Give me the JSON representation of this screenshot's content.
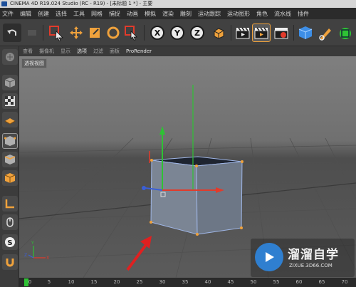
{
  "window": {
    "title": "CINEMA 4D R19.024 Studio (RC - R19) - [未标题 1 *] - 主要"
  },
  "menubar": {
    "items": [
      "文件",
      "编辑",
      "创建",
      "选择",
      "工具",
      "网格",
      "捕捉",
      "动画",
      "模拟",
      "渲染",
      "雕刻",
      "运动跟踪",
      "运动图形",
      "角色",
      "流水线",
      "插件"
    ]
  },
  "toolbar": {
    "axis_x": "X",
    "axis_y": "Y",
    "axis_z": "Z"
  },
  "viewport_menu": {
    "items": [
      "查看",
      "摄像机",
      "显示",
      "选项",
      "过滤",
      "面板",
      "ProRender"
    ]
  },
  "viewport": {
    "label": "透视视图",
    "axis_x_label": "X",
    "axis_y_label": "Y",
    "axis_z_label": "Z"
  },
  "timeline": {
    "ticks": [
      "0",
      "5",
      "10",
      "15",
      "20",
      "25",
      "30",
      "35",
      "40",
      "45",
      "50",
      "55",
      "60",
      "65",
      "70"
    ]
  },
  "watermark": {
    "title": "溜溜自学",
    "url": "ZIXUE.3D66.COM"
  },
  "colors": {
    "accent_orange": "#f0a23c",
    "axis_red": "#e23b2b",
    "axis_green": "#2ec234",
    "axis_blue": "#3a5fd8",
    "annotation_red": "#e02020"
  }
}
